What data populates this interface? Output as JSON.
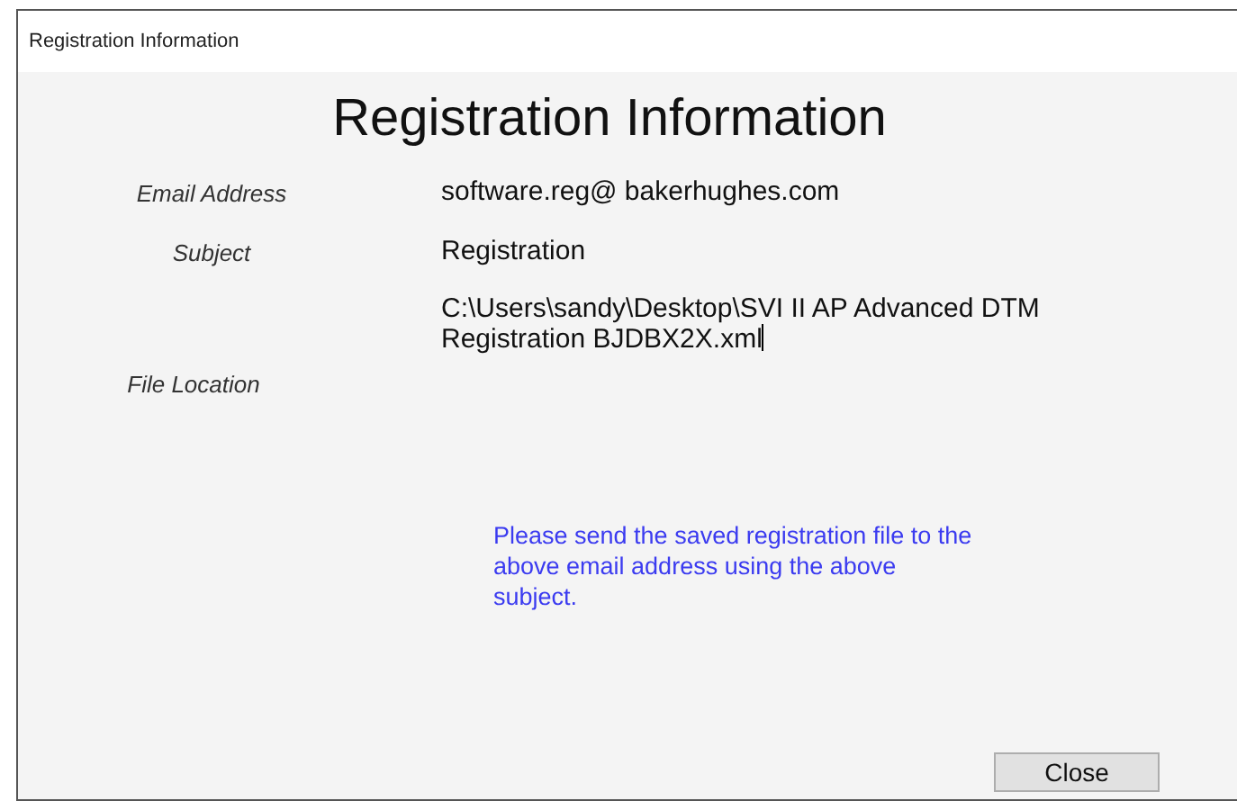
{
  "window": {
    "title": "Registration Information"
  },
  "heading": "Registration Information",
  "fields": [
    {
      "label": "Email Address",
      "value": "software.reg@ bakerhughes.com",
      "focused": false
    },
    {
      "label": "Subject",
      "value": "Registration",
      "focused": false
    },
    {
      "label": "File Location",
      "value": "C:\\Users\\sandy\\Desktop\\SVI II AP Advanced DTM Registration BJDBX2X.xml",
      "focused": true
    }
  ],
  "message": "Please send the saved registration file to the above email address using the above subject.",
  "buttons": [
    {
      "label": "Close"
    }
  ]
}
